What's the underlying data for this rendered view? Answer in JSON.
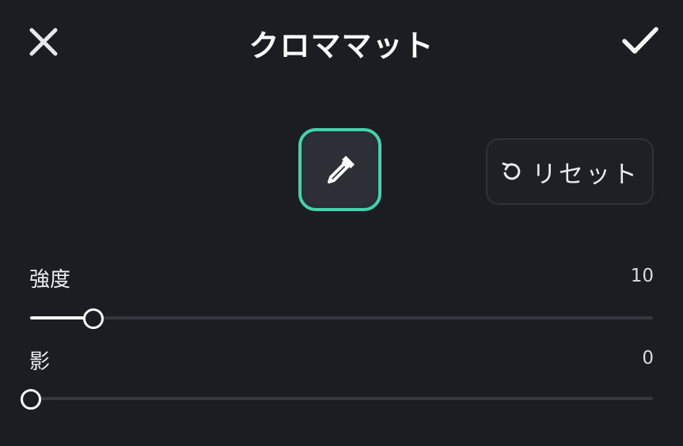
{
  "header": {
    "title": "クロママット",
    "close_icon": "close-icon",
    "confirm_icon": "check-icon"
  },
  "picker": {
    "icon": "eyedropper-icon",
    "accent_color": "#44d2ad"
  },
  "reset": {
    "label": "リセット",
    "icon": "reset-icon"
  },
  "sliders": [
    {
      "label": "強度",
      "value_text": "10",
      "value": 10,
      "min": 0,
      "max": 100
    },
    {
      "label": "影",
      "value_text": "0",
      "value": 0,
      "min": 0,
      "max": 100
    }
  ],
  "colors": {
    "background": "#1b1d22",
    "accent": "#44d2ad"
  }
}
